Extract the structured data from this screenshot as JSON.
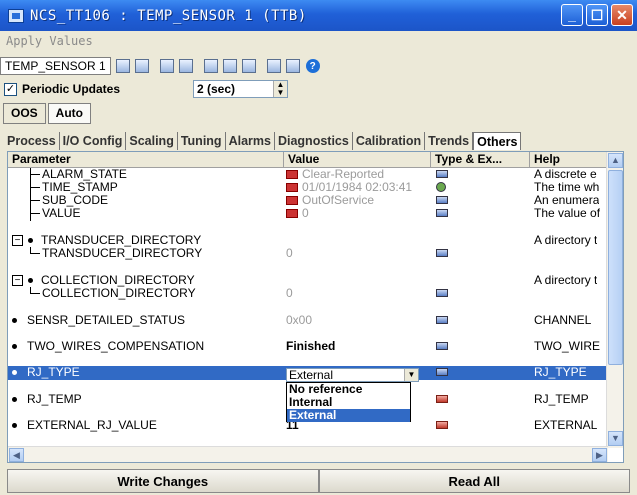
{
  "window": {
    "title": "NCS_TT106 : TEMP_SENSOR 1 (TTB)"
  },
  "menu": {
    "apply_values": "Apply Values"
  },
  "toolbar": {
    "block_name": "TEMP_SENSOR 1"
  },
  "periodic": {
    "label": "Periodic Updates",
    "checked": true,
    "interval": "2 (sec)"
  },
  "modes": [
    "OOS",
    "Auto"
  ],
  "tabs": [
    "Process",
    "I/O Config",
    "Scaling",
    "Tuning",
    "Alarms",
    "Diagnostics",
    "Calibration",
    "Trends",
    "Others"
  ],
  "active_tab": "Others",
  "columns": {
    "parameter": "Parameter",
    "value": "Value",
    "type": "Type & Ex...",
    "help": "Help"
  },
  "rows": [
    {
      "parameter": "ALARM_STATE",
      "value": "Clear-Reported",
      "help": "A discrete e"
    },
    {
      "parameter": "TIME_STAMP",
      "value": "01/01/1984 02:03:41",
      "help": "The time wh"
    },
    {
      "parameter": "SUB_CODE",
      "value": "OutOfService",
      "help": "An enumera"
    },
    {
      "parameter": "VALUE",
      "value": "0",
      "help": "The value of"
    },
    {
      "parameter": "TRANSDUCER_DIRECTORY",
      "value": "",
      "help": "A directory t"
    },
    {
      "parameter": "TRANSDUCER_DIRECTORY",
      "value": "0",
      "help": ""
    },
    {
      "parameter": "COLLECTION_DIRECTORY",
      "value": "",
      "help": "A directory t"
    },
    {
      "parameter": "COLLECTION_DIRECTORY",
      "value": "0",
      "help": ""
    },
    {
      "parameter": "SENSR_DETAILED_STATUS",
      "value": "0x00",
      "help": "CHANNEL"
    },
    {
      "parameter": "TWO_WIRES_COMPENSATION",
      "value": "Finished",
      "help": "TWO_WIRE"
    },
    {
      "parameter": "RJ_TYPE",
      "value": "External",
      "help": "RJ_TYPE"
    },
    {
      "parameter": "RJ_TEMP",
      "value": "",
      "help": "RJ_TEMP"
    },
    {
      "parameter": "EXTERNAL_RJ_VALUE",
      "value": "11",
      "help": "EXTERNAL"
    }
  ],
  "dropdown": {
    "options": [
      "No reference",
      "Internal",
      "External"
    ],
    "selected": "External"
  },
  "buttons": {
    "write": "Write Changes",
    "read": "Read All"
  }
}
